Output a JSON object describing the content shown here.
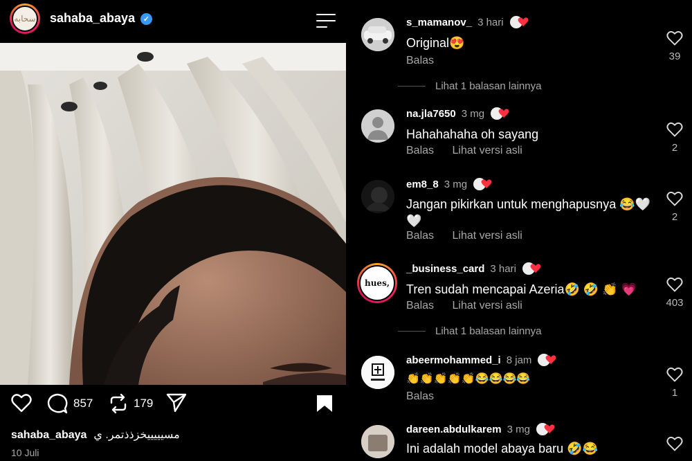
{
  "post": {
    "username": "sahaba_abaya",
    "avatar_text": "سحابه",
    "likes": "857",
    "reposts": "179",
    "caption_user": "sahaba_abaya",
    "caption_text": "مسيييييخزذذتمر. ي",
    "date": "10 Juli"
  },
  "comments": [
    {
      "user": "s_mamanov_",
      "time": "3 hari",
      "text": "Original😍",
      "likes": "39",
      "reply": "Balas",
      "translate": ""
    },
    {
      "user": "na.jla7650",
      "time": "3 mg",
      "text": "Hahahahaha oh sayang",
      "likes": "2",
      "reply": "Balas",
      "translate": "Lihat versi asli"
    },
    {
      "user": "em8_8",
      "time": "3 mg",
      "text": "Jangan pikirkan untuk menghapusnya 😂🤍🤍",
      "likes": "2",
      "reply": "Balas",
      "translate": "Lihat versi asli"
    },
    {
      "user": "_business_card",
      "time": "3 hari",
      "text": "Tren sudah mencapai Azeria🤣 🤣 👏 💗",
      "likes": "403",
      "reply": "Balas",
      "translate": "Lihat versi asli",
      "avatar_text": "hues,"
    },
    {
      "user": "abeermohammed_i",
      "time": "8 jam",
      "text": "👏👏👏👏👏😂😂😂😂",
      "likes": "1",
      "reply": "Balas",
      "translate": ""
    },
    {
      "user": "dareen.abdulkarem",
      "time": "3 mg",
      "text": "Ini adalah model abaya baru 🤣😂",
      "likes": "",
      "reply": "",
      "translate": ""
    }
  ],
  "more_replies": [
    "Lihat 1 balasan lainnya",
    "Lihat 1 balasan lainnya"
  ],
  "colors": {
    "accent_heart": "#ff3040",
    "verified": "#3897f0",
    "background": "#000000"
  }
}
